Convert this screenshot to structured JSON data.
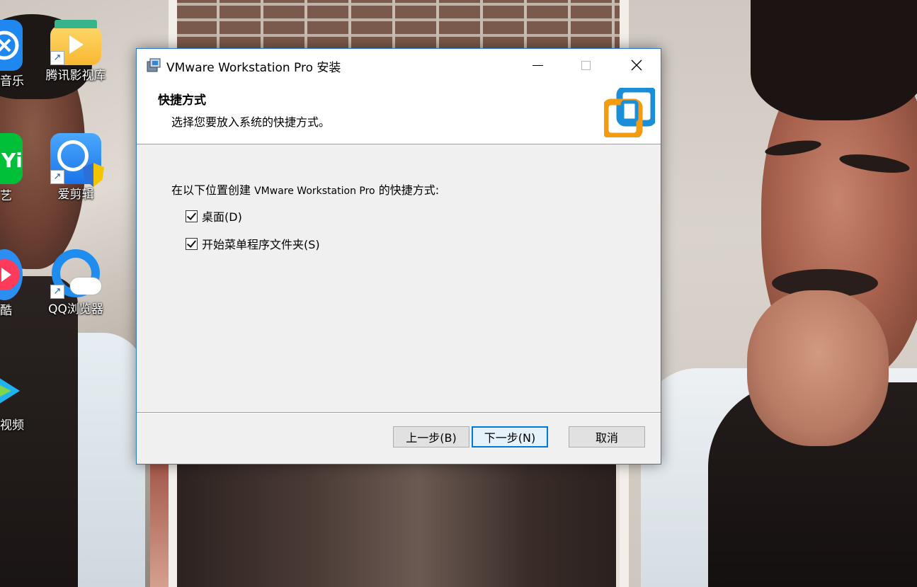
{
  "desktop": {
    "icons": [
      {
        "label": "腾讯影视库"
      },
      {
        "label": "爱剪辑"
      },
      {
        "label": "QQ浏览器"
      }
    ],
    "partial_icons": [
      {
        "label": "音乐"
      },
      {
        "label": "艺"
      },
      {
        "label": "酷"
      },
      {
        "label": "视频"
      }
    ]
  },
  "window": {
    "title": "VMware Workstation Pro 安装",
    "header": {
      "title": "快捷方式",
      "subtitle": "选择您要放入系统的快捷方式。"
    },
    "intro_prefix": "在以下位置创建",
    "intro_product": "VMware Workstation Pro",
    "intro_suffix": "的快捷方式:",
    "options": [
      {
        "label": "桌面(D)",
        "checked": true
      },
      {
        "label": "开始菜单程序文件夹(S)",
        "checked": true
      }
    ],
    "buttons": {
      "back": "上一步(B)",
      "next": "下一步(N)",
      "cancel": "取消"
    }
  },
  "colors": {
    "accent": "#0078d7",
    "window_border": "#2b79d0",
    "logo_orange": "#f39c12",
    "logo_blue": "#1b8ed8"
  }
}
